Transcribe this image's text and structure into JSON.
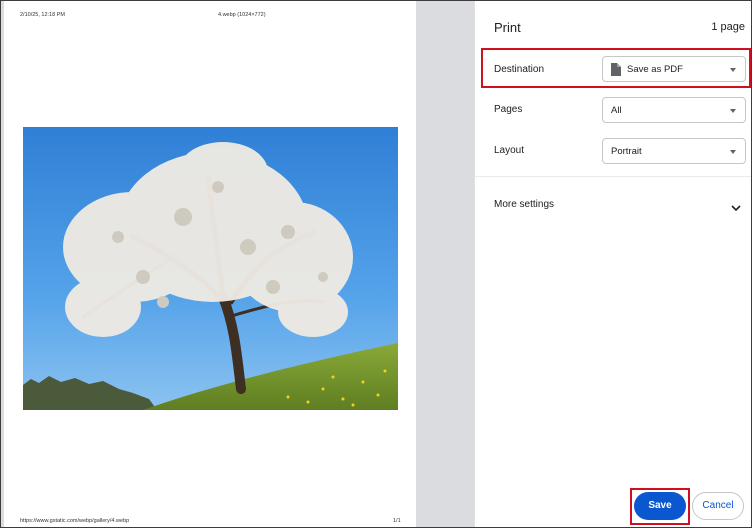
{
  "preview": {
    "header_left": "2/10/25, 12:18 PM",
    "header_center": "4.webp (1024×772)",
    "footer_left": "https://www.gstatic.com/webp/gallery/4.webp",
    "footer_right": "1/1"
  },
  "panel": {
    "title": "Print",
    "page_count": "1 page",
    "destination": {
      "label": "Destination",
      "value": "Save as PDF",
      "icon": "document-icon"
    },
    "pages": {
      "label": "Pages",
      "value": "All"
    },
    "layout": {
      "label": "Layout",
      "value": "Portrait"
    },
    "more_settings": "More settings"
  },
  "buttons": {
    "save": "Save",
    "cancel": "Cancel"
  },
  "colors": {
    "accent": "#0b57d0",
    "highlight": "#d0101e",
    "preview_background": "#dadce0"
  }
}
